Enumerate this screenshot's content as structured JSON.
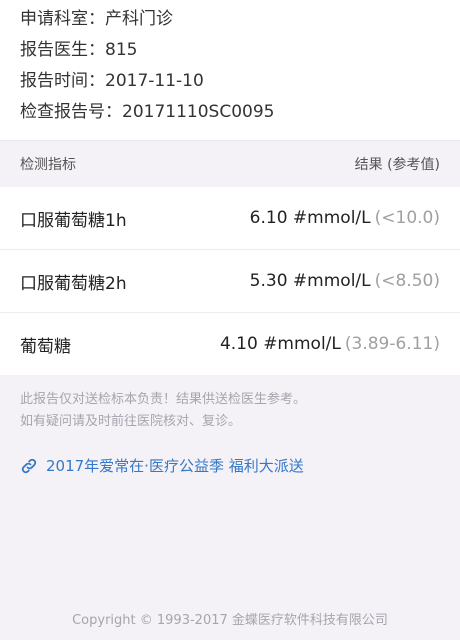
{
  "info": {
    "department": "申请科室：产科门诊",
    "doctor": "报告医生：815",
    "time": "报告时间：2017-11-10",
    "report_no": "检查报告号：20171110SC0095"
  },
  "table": {
    "header_item": "检测指标",
    "header_result": "结果 (参考值)",
    "rows": [
      {
        "name": "口服葡萄糖1h",
        "value": "6.10 #mmol/L",
        "ref": "(<10.0)"
      },
      {
        "name": "口服葡萄糖2h",
        "value": "5.30 #mmol/L",
        "ref": "(<8.50)"
      },
      {
        "name": "葡萄糖",
        "value": "4.10 #mmol/L",
        "ref": "(3.89-6.11)"
      }
    ]
  },
  "notice": {
    "line1": "此报告仅对送检标本负责！结果供送检医生参考。",
    "line2": "如有疑问请及时前往医院核对、复诊。"
  },
  "promo": {
    "icon": "link-icon",
    "text": "2017年爱常在·医疗公益季 福利大派送",
    "color": "#3478c8"
  },
  "footer": {
    "copyright": "Copyright © 1993-2017 金蝶医疗软件科技有限公司"
  }
}
